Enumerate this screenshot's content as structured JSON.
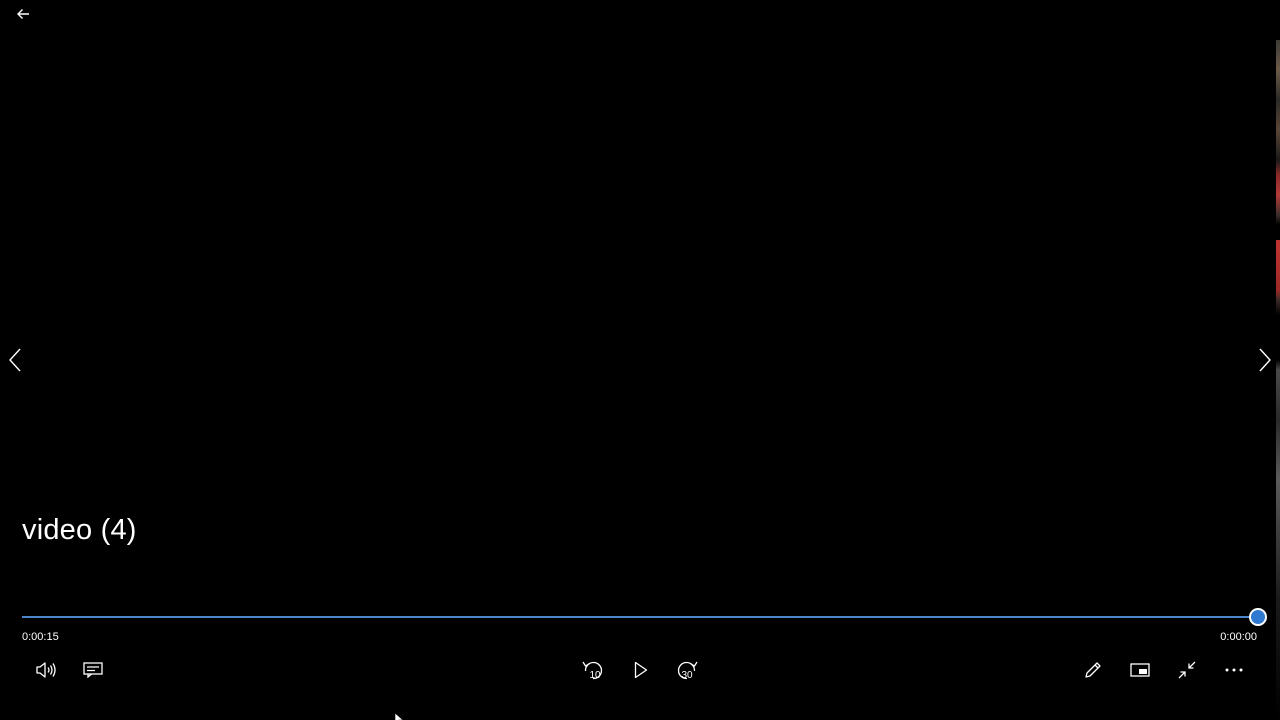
{
  "video": {
    "title": "video (4)",
    "elapsed": "0:00:15",
    "remaining": "0:00:00",
    "progress": 1.0
  },
  "controls": {
    "rewind_seconds": "10",
    "forward_seconds": "30"
  },
  "icons": {
    "back": "back-arrow-icon",
    "prev": "chevron-left-icon",
    "next": "chevron-right-icon",
    "volume": "volume-icon",
    "subtitles": "subtitles-icon",
    "rewind": "skip-back-10-icon",
    "play": "play-icon",
    "forward": "skip-forward-30-icon",
    "edit": "pencil-icon",
    "mini_view": "mini-view-icon",
    "exit_fullscreen": "exit-fullscreen-icon",
    "more": "more-icon"
  },
  "colors": {
    "background": "#000000",
    "accent": "#2f7ad0",
    "foreground": "#ffffff"
  }
}
